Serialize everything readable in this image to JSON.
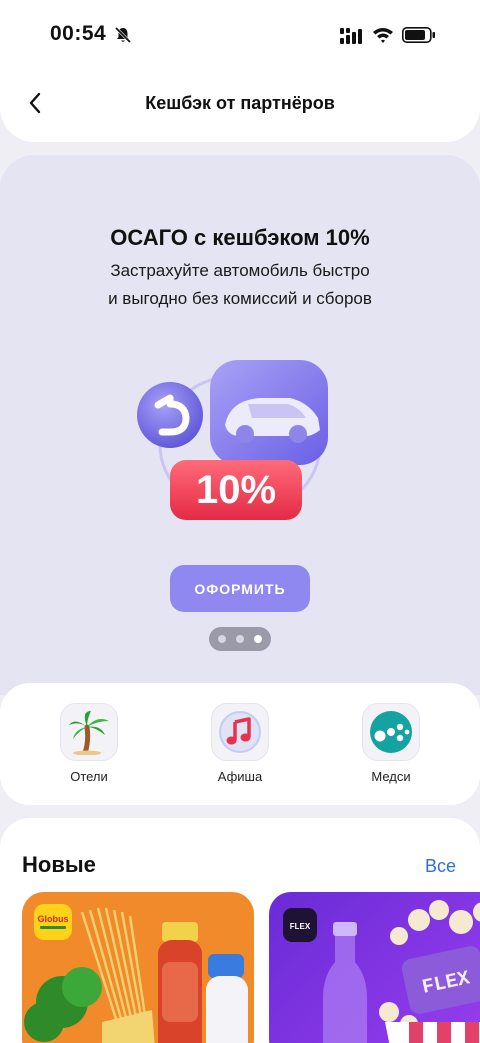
{
  "status_bar": {
    "time": "00:54"
  },
  "header": {
    "title": "Кешбэк от партнёров"
  },
  "promo": {
    "title": "ОСАГО с кешбэком 10%",
    "subtitle_line1": "Застрахуйте автомобиль быстро",
    "subtitle_line2": "и выгодно без комиссий и сборов",
    "badge": "10%",
    "button": "ОФОРМИТЬ",
    "pager": {
      "total": 3,
      "active_index": 2
    }
  },
  "partners": [
    {
      "label": "Отели",
      "icon": "palm-tree-icon"
    },
    {
      "label": "Афиша",
      "icon": "music-note-icon"
    },
    {
      "label": "Медси",
      "icon": "medsi-logo-icon"
    }
  ],
  "new_section": {
    "title": "Новые",
    "all_link": "Все",
    "cards": [
      {
        "brand": "globus",
        "logo_text": "Globus",
        "color": "#f08a2a"
      },
      {
        "brand": "flex",
        "logo_text": "FLEX",
        "color": "#7a33e0"
      }
    ]
  },
  "colors": {
    "accent_button": "#8e88f0",
    "badge_red": "#ef4257",
    "link_blue": "#2f6fd6"
  }
}
